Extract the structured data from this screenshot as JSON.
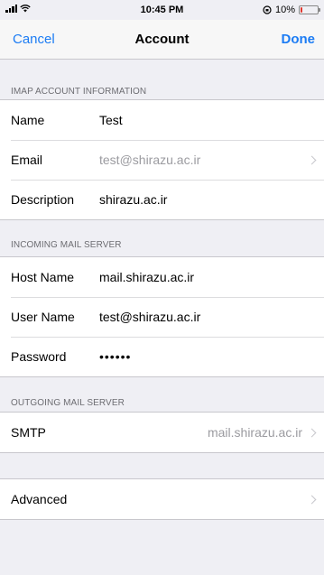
{
  "status_bar": {
    "time": "10:45 PM",
    "battery_percent": "10%",
    "battery_level": 0.1
  },
  "nav": {
    "cancel_label": "Cancel",
    "title": "Account",
    "done_label": "Done"
  },
  "imap_section": {
    "header": "IMAP ACCOUNT INFORMATION",
    "rows": [
      {
        "label": "Name",
        "value": "Test"
      },
      {
        "label": "Email",
        "value": "test@shirazu.ac.ir"
      },
      {
        "label": "Description",
        "value": "shirazu.ac.ir"
      }
    ]
  },
  "incoming_section": {
    "header": "INCOMING MAIL SERVER",
    "rows": [
      {
        "label": "Host Name",
        "value": "mail.shirazu.ac.ir"
      },
      {
        "label": "User Name",
        "value": "test@shirazu.ac.ir"
      },
      {
        "label": "Password",
        "value": "••••••"
      }
    ]
  },
  "outgoing_section": {
    "header": "OUTGOING MAIL SERVER",
    "smtp_label": "SMTP",
    "smtp_value": "mail.shirazu.ac.ir"
  },
  "advanced": {
    "label": "Advanced"
  },
  "colors": {
    "accent": "#1c7cf4",
    "background": "#efeff4",
    "battery_low": "#e0362c"
  }
}
